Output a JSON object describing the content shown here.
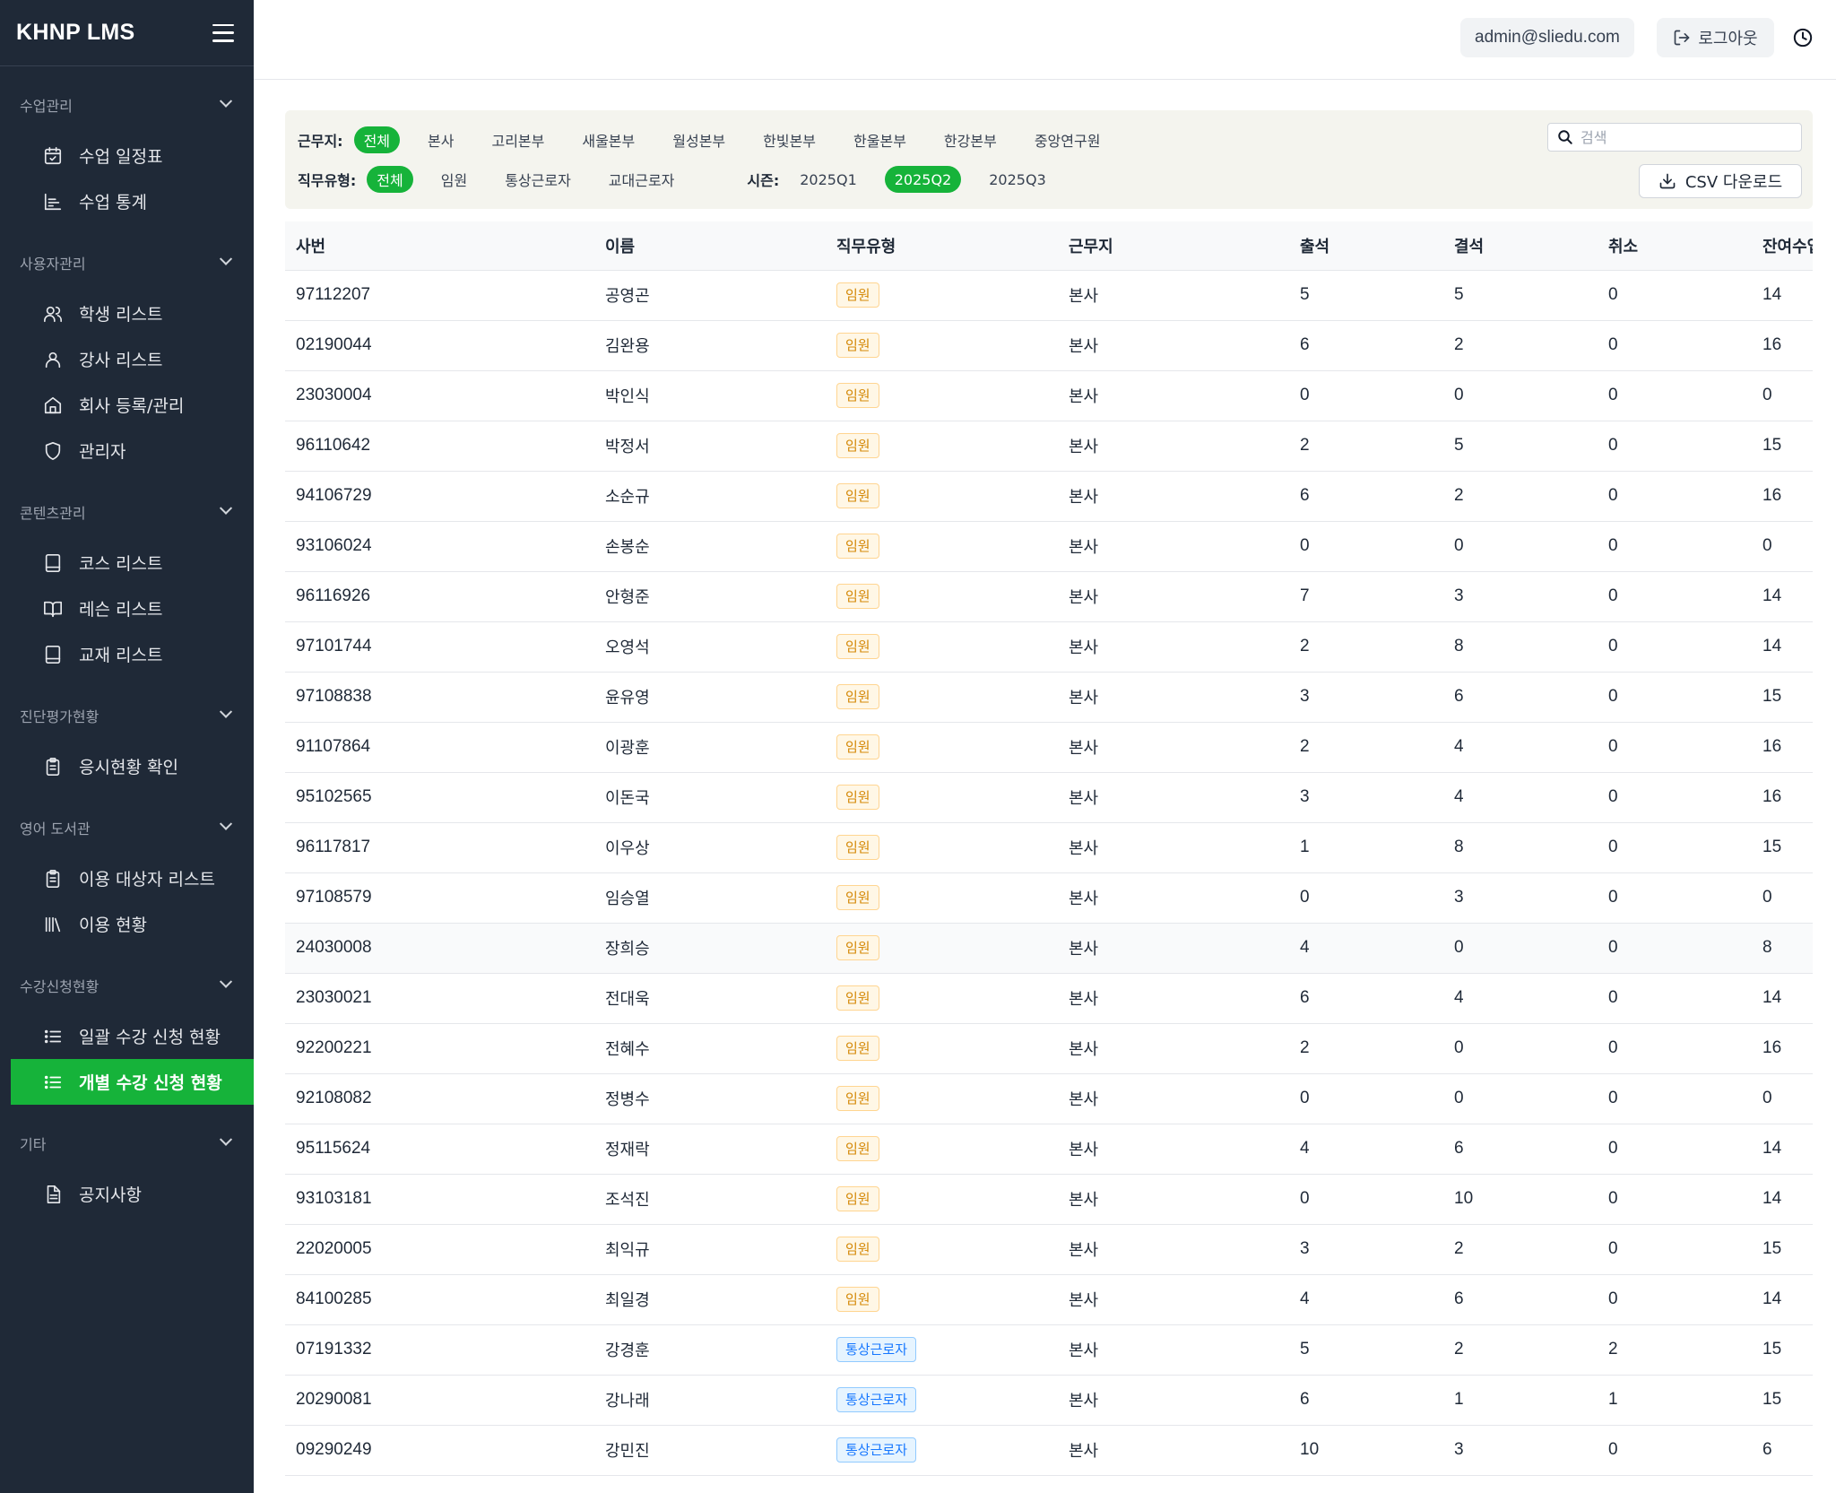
{
  "app": {
    "title": "KHNP LMS"
  },
  "sidebar": {
    "sections": [
      {
        "label": "수업관리",
        "items": [
          {
            "label": "수업 일정표",
            "icon": "calendar-check-icon"
          },
          {
            "label": "수업 통계",
            "icon": "chart-icon"
          }
        ]
      },
      {
        "label": "사용자관리",
        "items": [
          {
            "label": "학생 리스트",
            "icon": "users-icon"
          },
          {
            "label": "강사 리스트",
            "icon": "user-icon"
          },
          {
            "label": "회사 등록/관리",
            "icon": "home-icon"
          },
          {
            "label": "관리자",
            "icon": "shield-icon"
          }
        ]
      },
      {
        "label": "콘텐츠관리",
        "items": [
          {
            "label": "코스 리스트",
            "icon": "book-icon"
          },
          {
            "label": "레슨 리스트",
            "icon": "book-open-icon"
          },
          {
            "label": "교재 리스트",
            "icon": "book-icon"
          }
        ]
      },
      {
        "label": "진단평가현황",
        "items": [
          {
            "label": "응시현황 확인",
            "icon": "clipboard-icon"
          }
        ]
      },
      {
        "label": "영어 도서관",
        "items": [
          {
            "label": "이용 대상자 리스트",
            "icon": "clipboard-icon"
          },
          {
            "label": "이용 현황",
            "icon": "library-icon"
          }
        ]
      },
      {
        "label": "수강신청현황",
        "items": [
          {
            "label": "일괄 수강 신청 현황",
            "icon": "list-icon"
          },
          {
            "label": "개별 수강 신청 현황",
            "icon": "list-icon",
            "active": true
          }
        ]
      },
      {
        "label": "기타",
        "items": [
          {
            "label": "공지사항",
            "icon": "document-icon"
          }
        ]
      }
    ]
  },
  "header": {
    "email": "admin@sliedu.com",
    "logout_label": "로그아웃"
  },
  "filters": {
    "workplace_label": "근무지:",
    "workplaces": [
      "전체",
      "본사",
      "고리본부",
      "새울본부",
      "월성본부",
      "한빛본부",
      "한울본부",
      "한강본부",
      "중앙연구원"
    ],
    "workplace_selected": "전체",
    "jobtype_label": "직무유형:",
    "jobtypes": [
      "전체",
      "임원",
      "통상근로자",
      "교대근로자"
    ],
    "jobtype_selected": "전체",
    "season_label": "시즌:",
    "seasons": [
      "2025Q1",
      "2025Q2",
      "2025Q3"
    ],
    "season_selected": "2025Q2",
    "search_placeholder": "검색",
    "csv_label": "CSV 다운로드"
  },
  "table": {
    "columns": [
      "사번",
      "이름",
      "직무유형",
      "근무지",
      "출석",
      "결석",
      "취소",
      "잔여수업"
    ],
    "rows": [
      [
        "97112207",
        "공영곤",
        "임원",
        "본사",
        "5",
        "5",
        "0",
        "14"
      ],
      [
        "02190044",
        "김완용",
        "임원",
        "본사",
        "6",
        "2",
        "0",
        "16"
      ],
      [
        "23030004",
        "박인식",
        "임원",
        "본사",
        "0",
        "0",
        "0",
        "0"
      ],
      [
        "96110642",
        "박정서",
        "임원",
        "본사",
        "2",
        "5",
        "0",
        "15"
      ],
      [
        "94106729",
        "소순규",
        "임원",
        "본사",
        "6",
        "2",
        "0",
        "16"
      ],
      [
        "93106024",
        "손봉순",
        "임원",
        "본사",
        "0",
        "0",
        "0",
        "0"
      ],
      [
        "96116926",
        "안형준",
        "임원",
        "본사",
        "7",
        "3",
        "0",
        "14"
      ],
      [
        "97101744",
        "오영석",
        "임원",
        "본사",
        "2",
        "8",
        "0",
        "14"
      ],
      [
        "97108838",
        "윤유영",
        "임원",
        "본사",
        "3",
        "6",
        "0",
        "15"
      ],
      [
        "91107864",
        "이광훈",
        "임원",
        "본사",
        "2",
        "4",
        "0",
        "16"
      ],
      [
        "95102565",
        "이돈국",
        "임원",
        "본사",
        "3",
        "4",
        "0",
        "16"
      ],
      [
        "96117817",
        "이우상",
        "임원",
        "본사",
        "1",
        "8",
        "0",
        "15"
      ],
      [
        "97108579",
        "임승열",
        "임원",
        "본사",
        "0",
        "3",
        "0",
        "0"
      ],
      [
        "24030008",
        "장희승",
        "임원",
        "본사",
        "4",
        "0",
        "0",
        "8"
      ],
      [
        "23030021",
        "전대욱",
        "임원",
        "본사",
        "6",
        "4",
        "0",
        "14"
      ],
      [
        "92200221",
        "전혜수",
        "임원",
        "본사",
        "2",
        "0",
        "0",
        "16"
      ],
      [
        "92108082",
        "정병수",
        "임원",
        "본사",
        "0",
        "0",
        "0",
        "0"
      ],
      [
        "95115624",
        "정재락",
        "임원",
        "본사",
        "4",
        "6",
        "0",
        "14"
      ],
      [
        "93103181",
        "조석진",
        "임원",
        "본사",
        "0",
        "10",
        "0",
        "14"
      ],
      [
        "22020005",
        "최익규",
        "임원",
        "본사",
        "3",
        "2",
        "0",
        "15"
      ],
      [
        "84100285",
        "최일경",
        "임원",
        "본사",
        "4",
        "6",
        "0",
        "14"
      ],
      [
        "07191332",
        "강경훈",
        "통상근로자",
        "본사",
        "5",
        "2",
        "2",
        "15"
      ],
      [
        "20290081",
        "강나래",
        "통상근로자",
        "본사",
        "6",
        "1",
        "1",
        "15"
      ],
      [
        "09290249",
        "강민진",
        "통상근로자",
        "본사",
        "10",
        "3",
        "0",
        "6"
      ]
    ],
    "highlighted_row": 13
  }
}
